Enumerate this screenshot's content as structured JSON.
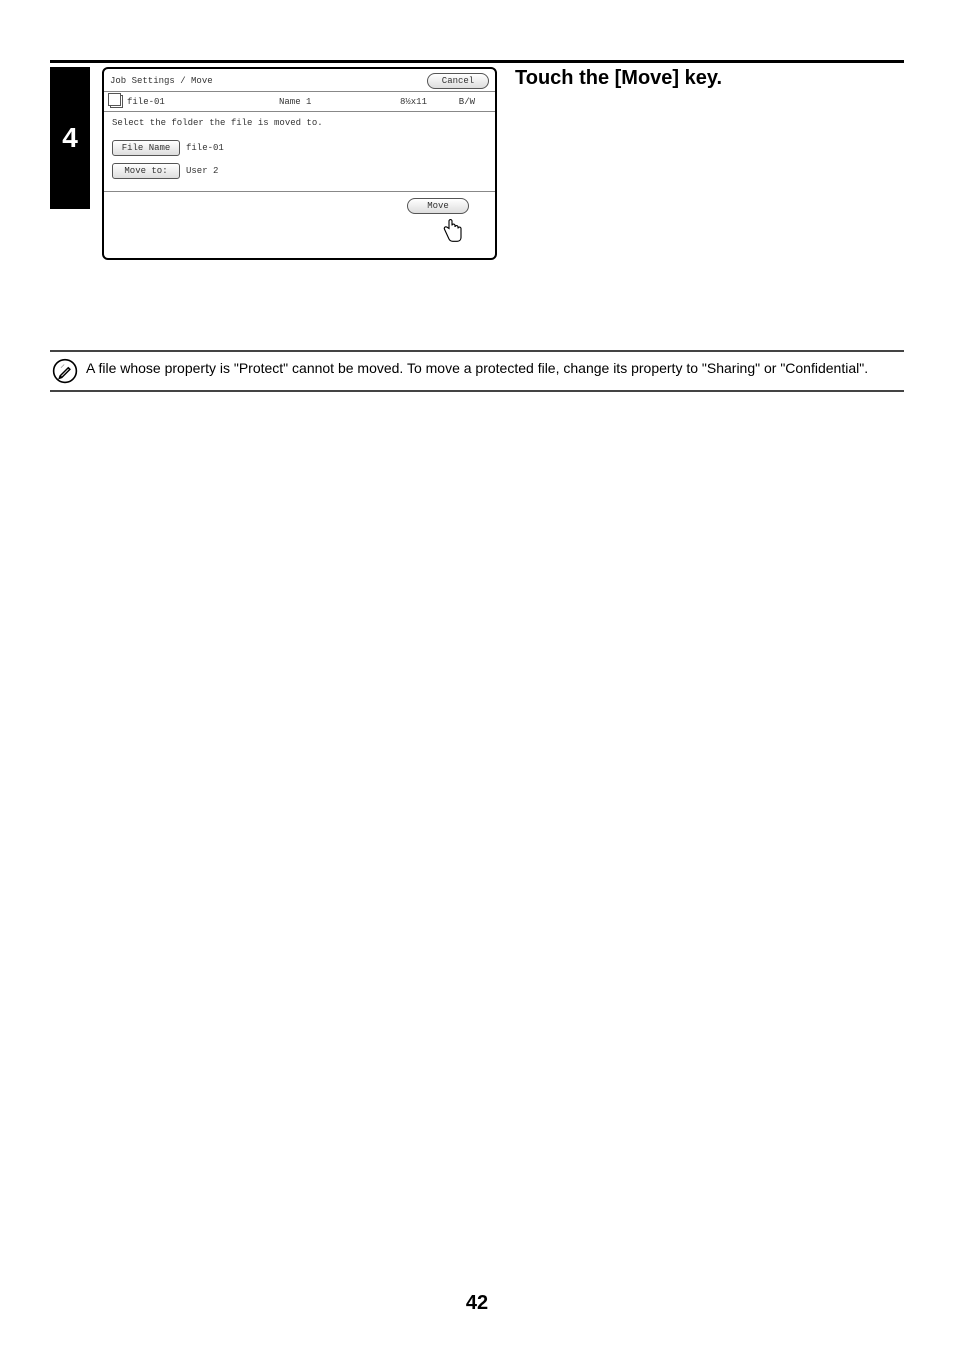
{
  "step_number": "4",
  "panel": {
    "title": "Job Settings / Move",
    "cancel": "Cancel",
    "file_id": "file-01",
    "name": "Name 1",
    "size": "8½x11",
    "color": "B/W",
    "message": "Select the folder the file is moved to.",
    "file_name_label": "File Name",
    "file_name_value": "file-01",
    "move_to_label": "Move to:",
    "move_to_value": "User 2",
    "move": "Move"
  },
  "heading": "Touch the [Move] key.",
  "note": "A file whose property is \"Protect\" cannot be moved. To move a protected file, change its property to \"Sharing\" or \"Confidential\".",
  "page_number": "42"
}
